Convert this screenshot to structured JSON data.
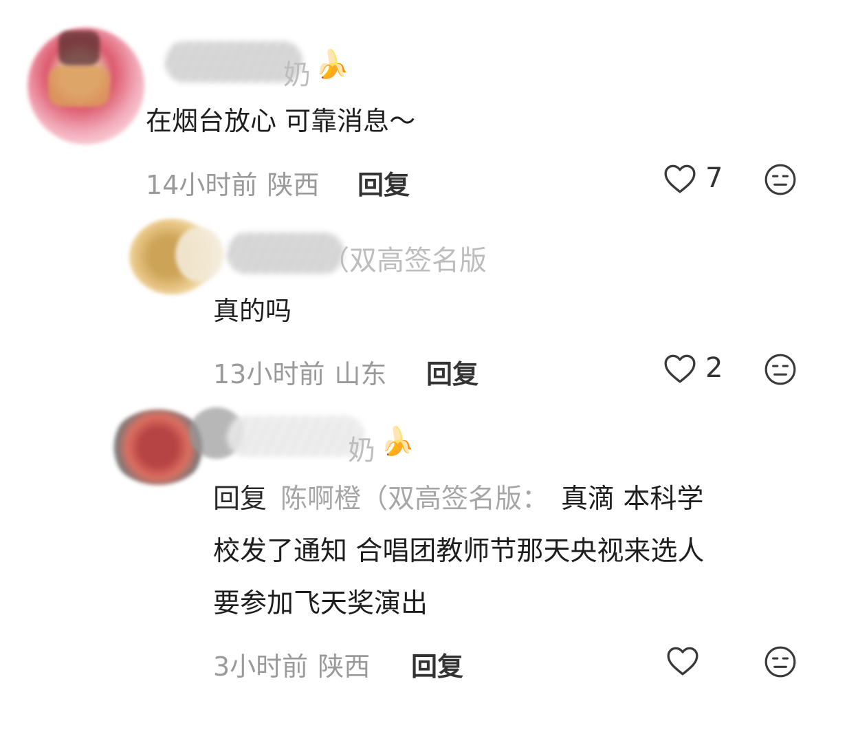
{
  "comments": [
    {
      "name_visible_suffix": "奶",
      "badge": "🍌",
      "text": "在烟台放心 可靠消息～",
      "time": "14小时前",
      "location": "陕西",
      "reply_label": "回复",
      "likes": "7"
    },
    {
      "name_visible_suffix": "（双高签名版",
      "text": "真的吗",
      "time": "13小时前",
      "location": "山东",
      "reply_label": "回复",
      "likes": "2"
    },
    {
      "name_visible_suffix": "奶",
      "badge": "🍌",
      "reply_prefix": "回复",
      "reply_target": "陈啊橙（双高签名版：",
      "text_line1": "真滴 本科学",
      "text_line2": "校发了通知 合唱团教师节那天央视来选人",
      "text_line3": "要参加飞天奖演出",
      "time": "3小时前",
      "location": "陕西",
      "reply_label": "回复",
      "likes": ""
    }
  ],
  "icons": {
    "like": "heart-outline-icon",
    "emoji": "neutral-face-icon"
  }
}
